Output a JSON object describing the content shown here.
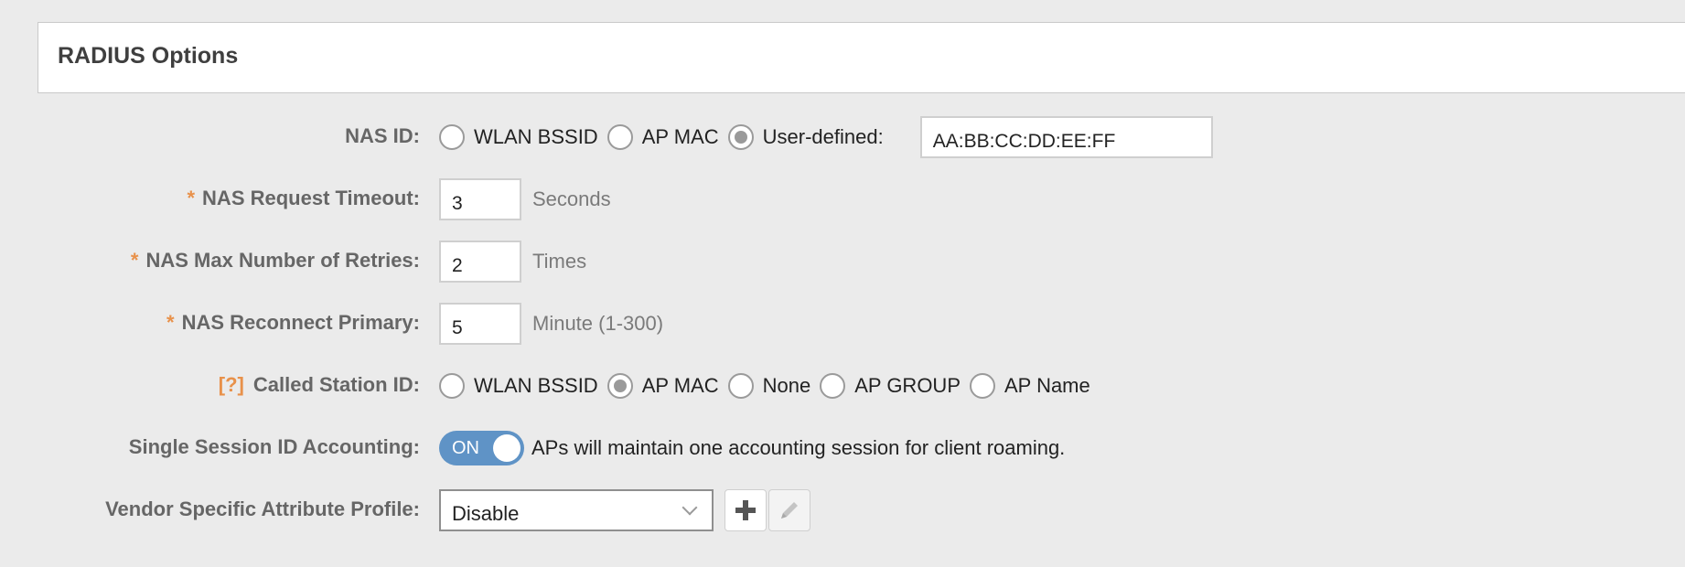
{
  "panel": {
    "title": "RADIUS Options"
  },
  "nas_id": {
    "label": "NAS ID:",
    "options": [
      "WLAN BSSID",
      "AP MAC",
      "User-defined:"
    ],
    "selected": "User-defined:",
    "value": "AA:BB:CC:DD:EE:FF"
  },
  "nas_request_timeout": {
    "required": "*",
    "label": "NAS Request Timeout:",
    "value": "3",
    "unit": "Seconds"
  },
  "nas_max_retries": {
    "required": "*",
    "label": "NAS Max Number of Retries:",
    "value": "2",
    "unit": "Times"
  },
  "nas_reconnect_primary": {
    "required": "*",
    "label": "NAS Reconnect Primary:",
    "value": "5",
    "unit": "Minute (1-300)"
  },
  "called_station_id": {
    "help": "[?]",
    "label": "Called Station ID:",
    "options": [
      "WLAN BSSID",
      "AP MAC",
      "None",
      "AP GROUP",
      "AP Name"
    ],
    "selected": "AP MAC"
  },
  "single_session": {
    "label": "Single Session ID Accounting:",
    "toggle": "ON",
    "description": "APs will maintain one accounting session for client roaming."
  },
  "vsa_profile": {
    "label": "Vendor Specific Attribute Profile:",
    "value": "Disable"
  },
  "colors": {
    "accent": "#5f93c6",
    "required": "#e8914a"
  },
  "icons": {
    "add": "plus-icon",
    "edit": "pencil-icon",
    "dropdown": "chevron-down-icon"
  }
}
